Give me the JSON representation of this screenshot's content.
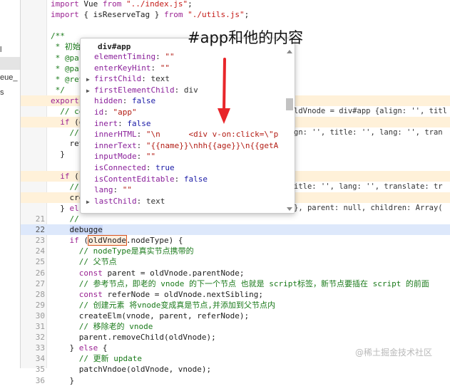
{
  "annotation": {
    "caption": "#app和他的内容"
  },
  "watermark": "@稀土掘金技术社区",
  "left_panel": {
    "items": [
      "l",
      "eue_",
      "s",
      "",
      "",
      ""
    ]
  },
  "editor": {
    "lines": [
      {
        "num": "",
        "html": "<span class='k'>import</span> Vue <span class='k'>from</span> <span class='s'>\"../index.js\"</span>;"
      },
      {
        "num": "",
        "html": "<span class='k'>import</span> { isReserveTag } <span class='k'>from</span> <span class='s'>\"./utils.js\"</span>;"
      },
      {
        "num": "",
        "html": ""
      },
      {
        "num": "",
        "html": "<span class='c'>/**</span>"
      },
      {
        "num": "",
        "html": "<span class='c'> * 初始</span>"
      },
      {
        "num": "",
        "html": "<span class='c'> * @par</span>"
      },
      {
        "num": "",
        "html": "<span class='c'> * @par</span>"
      },
      {
        "num": "",
        "html": "<span class='c'> * @ret</span>"
      },
      {
        "num": "",
        "html": "<span class='c'> */</span>"
      },
      {
        "num": "",
        "html": "<span class='k'>export</span>"
      },
      {
        "num": "",
        "html": "  <span class='c'>// co</span>"
      },
      {
        "num": "",
        "html": "  <span class='k'>if</span> (o"
      },
      {
        "num": "",
        "html": "    <span class='c'>//</span>"
      },
      {
        "num": "",
        "html": "    ret"
      },
      {
        "num": "",
        "html": "  }"
      },
      {
        "num": "",
        "html": ""
      },
      {
        "num": "",
        "html": "  <span class='k'>if</span> (!"
      },
      {
        "num": "",
        "html": "    <span class='c'>//</span>"
      },
      {
        "num": "",
        "html": "    cre"
      },
      {
        "num": "",
        "html": "  } <span class='k'>els</span>"
      },
      {
        "num": "21",
        "html": "    <span class='c'>//</span>"
      },
      {
        "num": "22",
        "html": "    <span class='debug-sel'>debugge</span>"
      },
      {
        "num": "23",
        "html": "    <span class='k'>if</span> (<span class='boxed'>oldVnode</span>.nodeType) {"
      },
      {
        "num": "24",
        "html": "      <span class='c'>// nodeType是真实节点携带的</span>"
      },
      {
        "num": "25",
        "html": "      <span class='c'>// 父节点</span>"
      },
      {
        "num": "26",
        "html": "      <span class='k'>const</span> parent = oldVnode.parentNode;"
      },
      {
        "num": "27",
        "html": "      <span class='c'>// 参考节点，即老的 vnode 的下一个节点 也就是 script标签，新节点要插在 script 的前面</span>"
      },
      {
        "num": "28",
        "html": "      <span class='k'>const</span> referNode = oldVnode.nextSibling;"
      },
      {
        "num": "29",
        "html": "      <span class='c'>// 创建元素 将vnode变成真是节点,并添加到父节点内</span>"
      },
      {
        "num": "30",
        "html": "      createElm(vnode, parent, referNode);"
      },
      {
        "num": "31",
        "html": "      <span class='c'>// 移除老的 vnode</span>"
      },
      {
        "num": "32",
        "html": "      parent.removeChild(oldVnode);"
      },
      {
        "num": "33",
        "html": "    } <span class='k'>else</span> {"
      },
      {
        "num": "34",
        "html": "      <span class='c'>// 更新 update</span>"
      },
      {
        "num": "35",
        "html": "      patchVndoe(oldVnode, vnode);"
      },
      {
        "num": "36",
        "html": "    }"
      }
    ],
    "inline_annotations": [
      {
        "line": 10,
        "text": "ldVnode = div#app {align: '', titl"
      },
      {
        "line": 12,
        "text": "gn: '', title: '', lang: '', tran"
      },
      {
        "line": 17,
        "text": "itle: '', lang: '', translate: tr"
      },
      {
        "line": 19,
        "text": "}, parent: null, children: Array("
      }
    ]
  },
  "popover": {
    "title": "div#app",
    "rows": [
      {
        "expand": false,
        "key": "elementTiming",
        "sep": ": ",
        "value": "\"\"",
        "vtype": "s"
      },
      {
        "expand": false,
        "key": "enterKeyHint",
        "sep": ": ",
        "value": "\"\"",
        "vtype": "s"
      },
      {
        "expand": true,
        "key": "firstChild",
        "sep": ": ",
        "value": "text",
        "vtype": "t"
      },
      {
        "expand": true,
        "key": "firstElementChild",
        "sep": ": ",
        "value": "div",
        "vtype": "t"
      },
      {
        "expand": false,
        "key": "hidden",
        "sep": ": ",
        "value": "false",
        "vtype": "k"
      },
      {
        "expand": false,
        "key": "id",
        "sep": ": ",
        "value": "\"app\"",
        "vtype": "s"
      },
      {
        "expand": false,
        "key": "inert",
        "sep": ": ",
        "value": "false",
        "vtype": "k"
      },
      {
        "expand": false,
        "key": "innerHTML",
        "sep": ": ",
        "value": "\"\\n      <div v-on:click=\\\"p",
        "vtype": "s"
      },
      {
        "expand": false,
        "key": "innerText",
        "sep": ": ",
        "value": "\"{{name}}\\nhh{{age}}\\n{{getA",
        "vtype": "s"
      },
      {
        "expand": false,
        "key": "inputMode",
        "sep": ": ",
        "value": "\"\"",
        "vtype": "s"
      },
      {
        "expand": false,
        "key": "isConnected",
        "sep": ": ",
        "value": "true",
        "vtype": "k"
      },
      {
        "expand": false,
        "key": "isContentEditable",
        "sep": ": ",
        "value": "false",
        "vtype": "k"
      },
      {
        "expand": false,
        "key": "lang",
        "sep": ": ",
        "value": "\"\"",
        "vtype": "s"
      },
      {
        "expand": true,
        "key": "lastChild",
        "sep": ": ",
        "value": "text",
        "vtype": "t"
      }
    ]
  },
  "colors": {
    "arrow": "#e8262a",
    "highlight_line": "#dde8fb",
    "hover_line": "#fff1d9"
  }
}
